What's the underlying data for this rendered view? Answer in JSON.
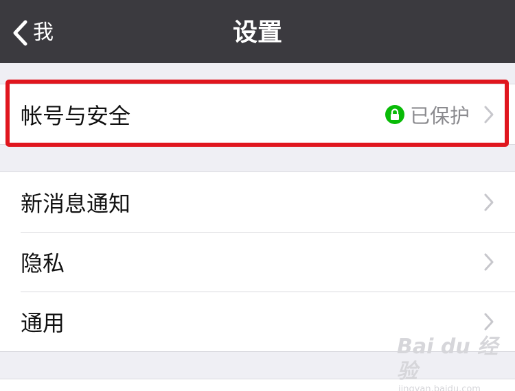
{
  "navbar": {
    "back_label": "我",
    "title": "设置"
  },
  "account_section": {
    "label": "帐号与安全",
    "status_text": "已保护",
    "status_icon": "lock-icon",
    "status_color": "#09bb07"
  },
  "settings_section": {
    "items": [
      {
        "label": "新消息通知"
      },
      {
        "label": "隐私"
      },
      {
        "label": "通用"
      }
    ]
  },
  "highlight_color": "#e0161e",
  "watermark": {
    "main": "Bai du 经验",
    "sub": "jingyan.baidu.com"
  }
}
